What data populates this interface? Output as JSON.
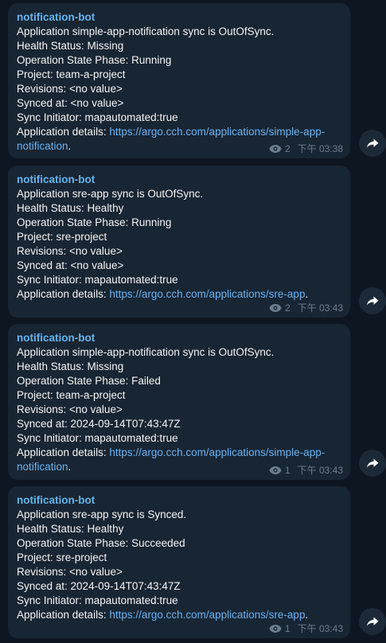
{
  "messages": [
    {
      "sender": "notification-bot",
      "lines": [
        "Application simple-app-notification sync is OutOfSync.",
        "Health Status: Missing",
        "Operation State Phase: Running",
        "Project: team-a-project",
        "Revisions: <no value>",
        "Synced at: <no value>",
        "Sync Initiator: mapautomated:true"
      ],
      "details_label": "Application details: ",
      "details_link": "https://argo.cch.com/applications/simple-app-notification",
      "details_suffix": ".",
      "views": "2",
      "time": "下午 03:38"
    },
    {
      "sender": "notification-bot",
      "lines": [
        "Application sre-app sync is OutOfSync.",
        "Health Status: Healthy",
        "Operation State Phase: Running",
        "Project: sre-project",
        "Revisions: <no value>",
        "Synced at: <no value>",
        "Sync Initiator: mapautomated:true"
      ],
      "details_label": "Application details: ",
      "details_link": "https://argo.cch.com/applications/sre-app",
      "details_suffix": ".",
      "views": "2",
      "time": "下午 03:43"
    },
    {
      "sender": "notification-bot",
      "lines": [
        "Application simple-app-notification sync is OutOfSync.",
        "Health Status: Missing",
        "Operation State Phase: Failed",
        "Project: team-a-project",
        "Revisions: <no value>",
        "Synced at: 2024-09-14T07:43:47Z",
        "Sync Initiator: mapautomated:true"
      ],
      "details_label": "Application details: ",
      "details_link": "https://argo.cch.com/applications/simple-app-notification",
      "details_suffix": ".",
      "views": "1",
      "time": "下午 03:43"
    },
    {
      "sender": "notification-bot",
      "lines": [
        "Application sre-app sync is Synced.",
        "Health Status: Healthy",
        "Operation State Phase: Succeeded",
        "Project: sre-project",
        "Revisions: <no value>",
        "Synced at: 2024-09-14T07:43:47Z",
        "Sync Initiator: mapautomated:true"
      ],
      "details_label": "Application details: ",
      "details_link": "https://argo.cch.com/applications/sre-app",
      "details_suffix": ".",
      "views": "1",
      "time": "下午 03:43"
    }
  ],
  "icons": {
    "views": "eye-icon",
    "forward": "share-forward-icon"
  },
  "colors": {
    "background": "#0e1621",
    "bubble": "#182533",
    "sender": "#64b5ef",
    "link": "#6ab3f3",
    "meta": "#6d7f8f"
  }
}
